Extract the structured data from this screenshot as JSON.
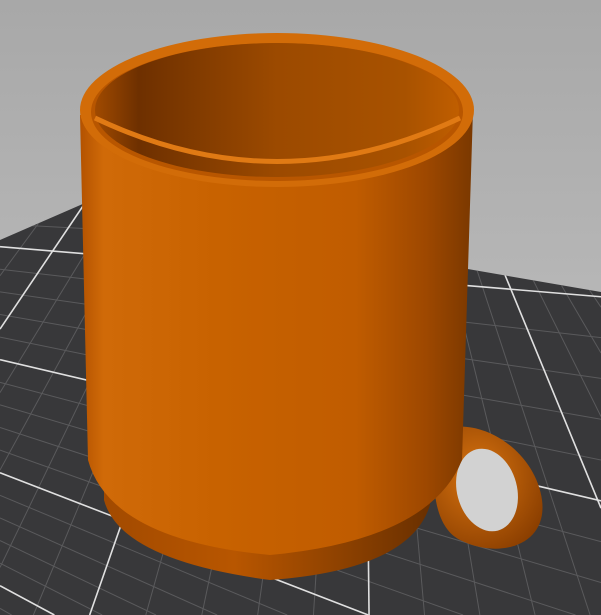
{
  "viewport": {
    "background_top": "#a9a9a9",
    "background_bottom": "#c4c4c4",
    "bed_color": "#3a3a3c",
    "grid_color": "#d8d8d8",
    "model_color": "#c45f00",
    "model_shadow_color": "#7a3600"
  }
}
